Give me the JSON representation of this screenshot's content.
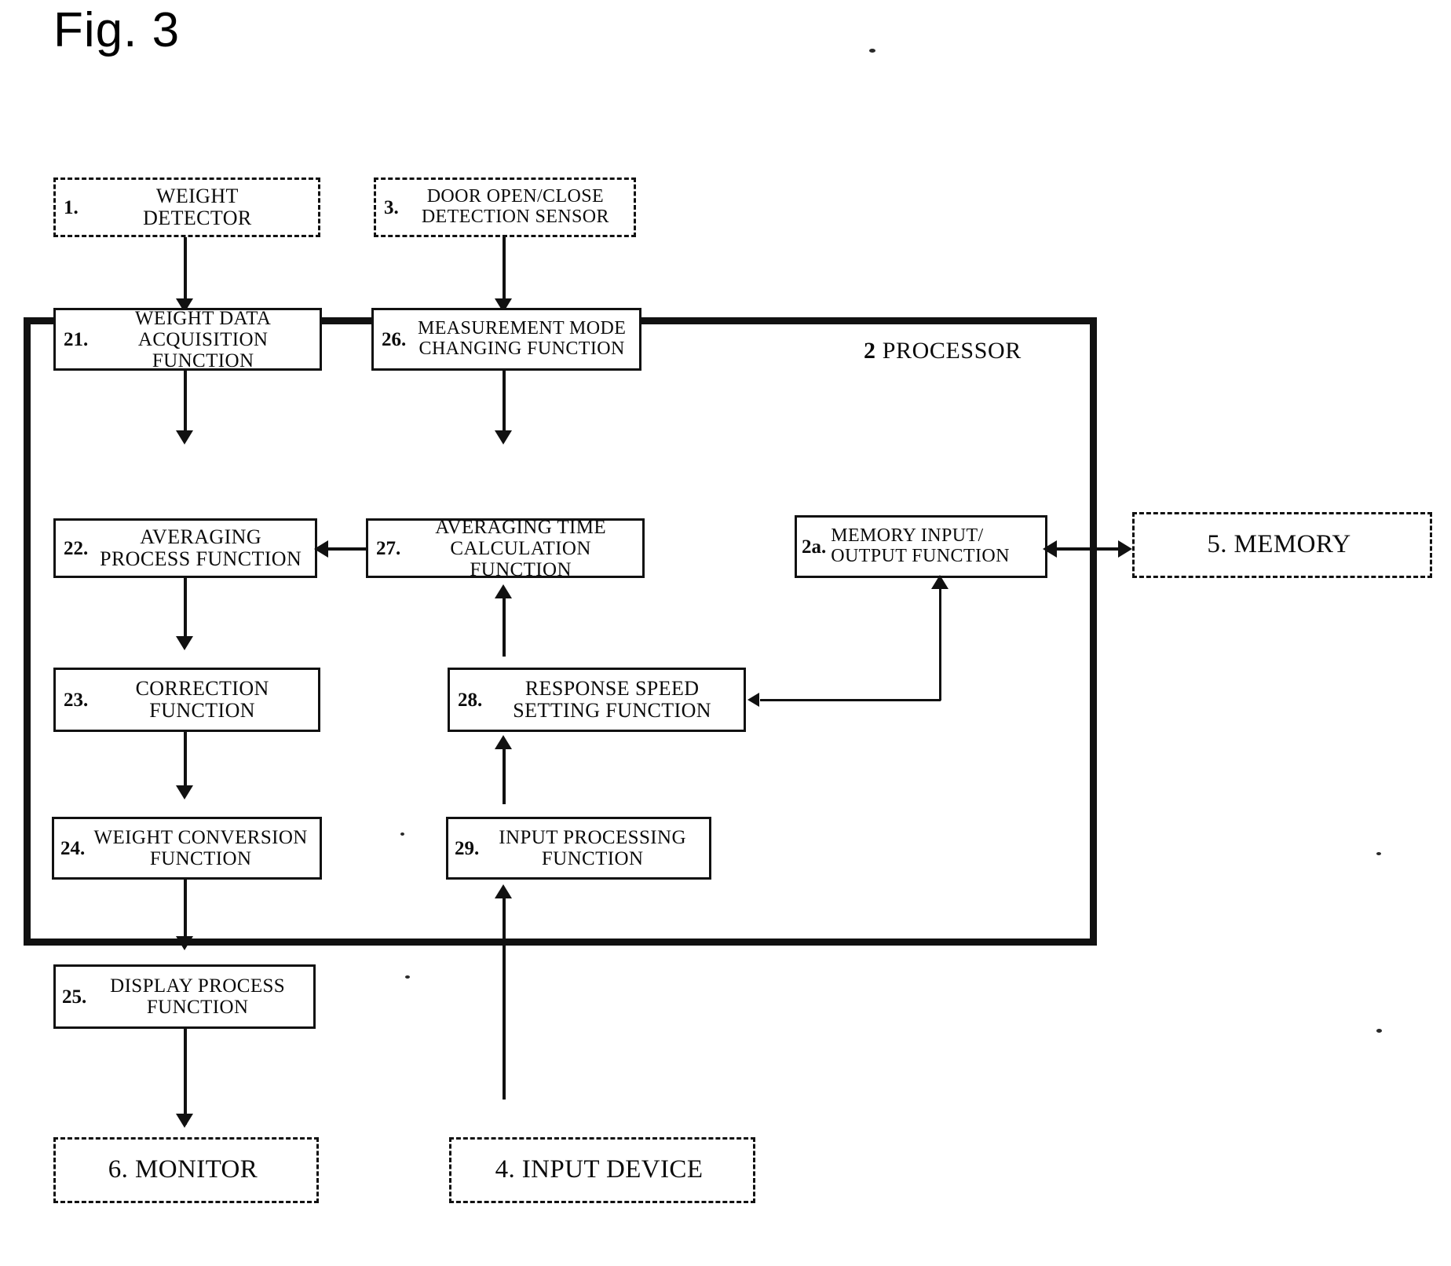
{
  "figure": {
    "title": "Fig. 3",
    "caption_number": "3"
  },
  "processor": {
    "number": "2",
    "label": "PROCESSOR"
  },
  "external_blocks": [
    {
      "id": "weight-detector",
      "number": "1.",
      "line1": "WEIGHT",
      "line2": "DETECTOR"
    },
    {
      "id": "door-sensor",
      "number": "3.",
      "line1": "DOOR OPEN/CLOSE",
      "line2": "DETECTION SENSOR"
    },
    {
      "id": "memory",
      "number": "5.",
      "line1": "MEMORY",
      "line2": ""
    },
    {
      "id": "monitor",
      "number": "6.",
      "line1": "MONITOR",
      "line2": ""
    },
    {
      "id": "input-device",
      "number": "4.",
      "line1": "INPUT DEVICE",
      "line2": ""
    }
  ],
  "function_blocks": [
    {
      "id": "weight-data-acquisition",
      "number": "21.",
      "line1": "WEIGHT DATA",
      "line2": "ACQUISITION FUNCTION"
    },
    {
      "id": "measurement-mode-changing",
      "number": "26.",
      "line1": "MEASUREMENT MODE",
      "line2": "CHANGING FUNCTION"
    },
    {
      "id": "averaging-process",
      "number": "22.",
      "line1": "AVERAGING",
      "line2": "PROCESS FUNCTION"
    },
    {
      "id": "averaging-time-calc",
      "number": "27.",
      "line1": "AVERAGING TIME",
      "line2": "CALCULATION FUNCTION"
    },
    {
      "id": "memory-io",
      "number": "2a.",
      "line1": "MEMORY INPUT/",
      "line2": "OUTPUT FUNCTION"
    },
    {
      "id": "correction",
      "number": "23.",
      "line1": "CORRECTION",
      "line2": "FUNCTION"
    },
    {
      "id": "response-speed-setting",
      "number": "28.",
      "line1": "RESPONSE SPEED",
      "line2": "SETTING FUNCTION"
    },
    {
      "id": "weight-conversion",
      "number": "24.",
      "line1": "WEIGHT CONVERSION",
      "line2": "FUNCTION"
    },
    {
      "id": "input-processing",
      "number": "29.",
      "line1": "INPUT PROCESSING",
      "line2": "FUNCTION"
    },
    {
      "id": "display-process",
      "number": "25.",
      "line1": "DISPLAY PROCESS",
      "line2": "FUNCTION"
    }
  ],
  "colors": {
    "ink": "#111111",
    "paper": "#ffffff"
  },
  "chart_data": {
    "type": "diagram",
    "title": "Fig. 3",
    "nodes": [
      {
        "ref": "1",
        "label": "WEIGHT DETECTOR",
        "style": "dashed",
        "group": "external"
      },
      {
        "ref": "3",
        "label": "DOOR OPEN/CLOSE DETECTION SENSOR",
        "style": "dashed",
        "group": "external"
      },
      {
        "ref": "5",
        "label": "MEMORY",
        "style": "dashed",
        "group": "external"
      },
      {
        "ref": "6",
        "label": "MONITOR",
        "style": "dashed",
        "group": "external"
      },
      {
        "ref": "4",
        "label": "INPUT DEVICE",
        "style": "dashed",
        "group": "external"
      },
      {
        "ref": "2",
        "label": "PROCESSOR",
        "style": "thick",
        "group": "container"
      },
      {
        "ref": "21",
        "label": "WEIGHT DATA ACQUISITION FUNCTION",
        "style": "solid",
        "group": "processor"
      },
      {
        "ref": "26",
        "label": "MEASUREMENT MODE CHANGING FUNCTION",
        "style": "solid",
        "group": "processor"
      },
      {
        "ref": "22",
        "label": "AVERAGING PROCESS FUNCTION",
        "style": "solid",
        "group": "processor"
      },
      {
        "ref": "27",
        "label": "AVERAGING TIME CALCULATION FUNCTION",
        "style": "solid",
        "group": "processor"
      },
      {
        "ref": "2a",
        "label": "MEMORY INPUT/OUTPUT FUNCTION",
        "style": "solid",
        "group": "processor"
      },
      {
        "ref": "23",
        "label": "CORRECTION FUNCTION",
        "style": "solid",
        "group": "processor"
      },
      {
        "ref": "28",
        "label": "RESPONSE SPEED SETTING FUNCTION",
        "style": "solid",
        "group": "processor"
      },
      {
        "ref": "24",
        "label": "WEIGHT CONVERSION FUNCTION",
        "style": "solid",
        "group": "processor"
      },
      {
        "ref": "29",
        "label": "INPUT PROCESSING FUNCTION",
        "style": "solid",
        "group": "processor"
      },
      {
        "ref": "25",
        "label": "DISPLAY PROCESS FUNCTION",
        "style": "solid",
        "group": "processor"
      }
    ],
    "edges": [
      {
        "from": "1",
        "to": "21",
        "dir": "down"
      },
      {
        "from": "21",
        "to": "22",
        "dir": "down"
      },
      {
        "from": "22",
        "to": "23",
        "dir": "down"
      },
      {
        "from": "23",
        "to": "24",
        "dir": "down"
      },
      {
        "from": "24",
        "to": "25",
        "dir": "down"
      },
      {
        "from": "25",
        "to": "6",
        "dir": "down"
      },
      {
        "from": "3",
        "to": "26",
        "dir": "down"
      },
      {
        "from": "26",
        "to": "27",
        "dir": "down"
      },
      {
        "from": "27",
        "to": "22",
        "dir": "left"
      },
      {
        "from": "5",
        "to": "2a",
        "dir": "left"
      },
      {
        "from": "2a",
        "to": "5",
        "dir": "right"
      },
      {
        "from": "2a",
        "to": "28",
        "dir": "left"
      },
      {
        "from": "28",
        "to": "27",
        "dir": "up"
      },
      {
        "from": "29",
        "to": "28",
        "dir": "up"
      },
      {
        "from": "4",
        "to": "29",
        "dir": "up"
      }
    ]
  }
}
